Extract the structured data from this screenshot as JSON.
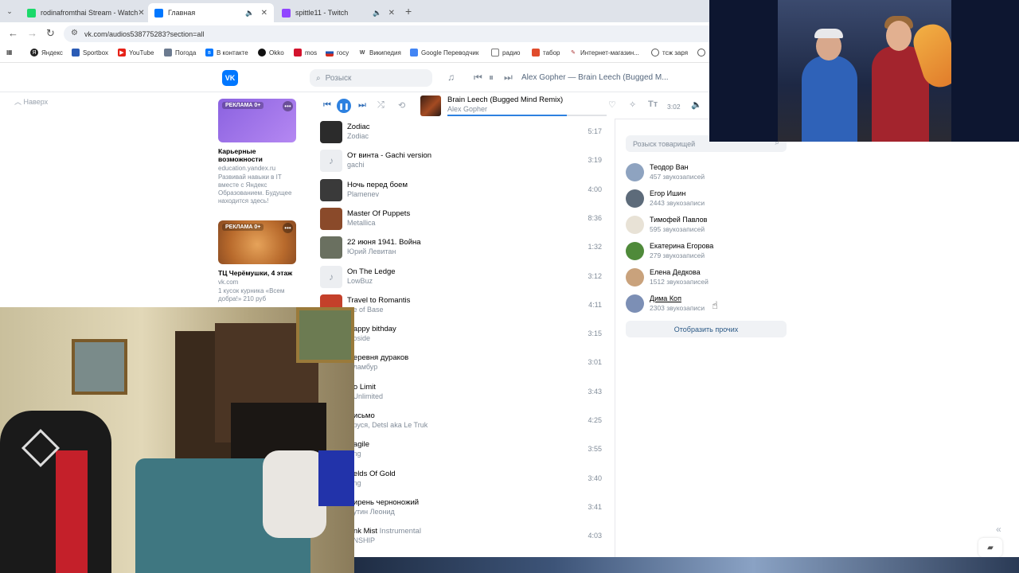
{
  "browser": {
    "tabs": [
      {
        "title": "rodinafromthai Stream - Watch",
        "favicon_color": "#1bd96a",
        "active": false
      },
      {
        "title": "Главная",
        "favicon_color": "#0077ff",
        "active": true
      },
      {
        "title": "spittle11 - Twitch",
        "favicon_color": "#9146ff",
        "active": false
      }
    ],
    "url": "vk.com/audios538775283?section=all",
    "bookmarks": [
      {
        "label": "Яндекс",
        "color": "#222"
      },
      {
        "label": "Sportbox",
        "color": "#2a5bb5"
      },
      {
        "label": "YouTube",
        "color": "#e62117"
      },
      {
        "label": "Погода",
        "color": "#6b7a8f"
      },
      {
        "label": "В контакте",
        "color": "#0077ff"
      },
      {
        "label": "Okko",
        "color": "#111"
      },
      {
        "label": "mos",
        "color": "#d3132d"
      },
      {
        "label": "госу",
        "color": "#1f56b3"
      },
      {
        "label": "Википедия",
        "color": "#444"
      },
      {
        "label": "Google Переводчик",
        "color": "#4285f4"
      },
      {
        "label": "радио",
        "color": "#777"
      },
      {
        "label": "табор",
        "color": "#e04c2c"
      },
      {
        "label": "Интернет-магазин...",
        "color": "#a33"
      },
      {
        "label": "тсж заря",
        "color": "#555"
      }
    ]
  },
  "vk": {
    "search_placeholder": "Розыск",
    "header_now_playing": "Alex Gopher — Brain Leech (Bugged M...",
    "back_link": "Наверх",
    "ads": [
      {
        "badge": "РЕКЛАМА 0+",
        "title": "Карьерные возможности",
        "domain": "education.yandex.ru",
        "text": "Развивай навыки в IT вместе с Яндекс Образованием. Будущее находится здесь!"
      },
      {
        "badge": "РЕКЛАМА 0+",
        "title": "ТЦ Черёмушки, 4 этаж",
        "domain": "vk.com",
        "text": "1 кусок курника «Всем добра!» 210 руб"
      }
    ],
    "player": {
      "title": "Brain Leech (Bugged Mind Remix)",
      "artist": "Alex Gopher",
      "time": "3:02",
      "progress": 0.75
    },
    "tracks": [
      {
        "title": "Zodiac",
        "subtitle": "",
        "artist": "Zodiac",
        "duration": "5:17",
        "cover": "#2b2b2b",
        "note": false
      },
      {
        "title": "От винта - Gachi version",
        "subtitle": "",
        "artist": "gachi",
        "duration": "3:19",
        "cover": "#eceef1",
        "note": true
      },
      {
        "title": "Ночь перед боем",
        "subtitle": "",
        "artist": "Plamenev",
        "duration": "4:00",
        "cover": "#3a3a3a",
        "note": false
      },
      {
        "title": "Master Of Puppets",
        "subtitle": "",
        "artist": "Metallica",
        "duration": "8:36",
        "cover": "#8a4a2a",
        "note": false
      },
      {
        "title": "22 июня 1941. Война",
        "subtitle": "",
        "artist": "Юрий Левитан",
        "duration": "1:32",
        "cover": "#6a7060",
        "note": false
      },
      {
        "title": "On The Ledge",
        "subtitle": "",
        "artist": "LowBuz",
        "duration": "3:12",
        "cover": "#eceef1",
        "note": true
      },
      {
        "title": "Travel to Romantis",
        "subtitle": "",
        "artist": "...e of Base",
        "duration": "4:11",
        "cover": "#c4402a",
        "note": false
      },
      {
        "title": "...appy bithday",
        "subtitle": "",
        "artist": "...oside",
        "duration": "3:15",
        "cover": "#eceef1",
        "note": true
      },
      {
        "title": "...еревня дураков",
        "subtitle": "",
        "artist": "...ламбур",
        "duration": "3:01",
        "cover": "#eceef1",
        "note": true
      },
      {
        "title": "...o Limit",
        "subtitle": "",
        "artist": "...Unlimited",
        "duration": "3:43",
        "cover": "#eceef1",
        "note": true
      },
      {
        "title": "...исьмо",
        "subtitle": "",
        "artist": "...руся, Detsl aka Le Truk",
        "duration": "4:25",
        "cover": "#eceef1",
        "note": true
      },
      {
        "title": "...agile",
        "subtitle": "",
        "artist": "...ng",
        "duration": "3:55",
        "cover": "#eceef1",
        "note": true
      },
      {
        "title": "...elds Of Gold",
        "subtitle": "",
        "artist": "...ng",
        "duration": "3:40",
        "cover": "#eceef1",
        "note": true
      },
      {
        "title": "...ирень черноножий",
        "subtitle": "",
        "artist": "...утин Леонид",
        "duration": "3:41",
        "cover": "#eceef1",
        "note": true
      },
      {
        "title": "...nk Mist",
        "subtitle": "Instrumental",
        "artist": "...NSHIP",
        "duration": "4:03",
        "cover": "#eceef1",
        "note": true
      }
    ],
    "friends_search_placeholder": "Розыск товарищей",
    "friends": [
      {
        "name": "Теодор Ван",
        "count": "457 звукозаписей",
        "avatar": "#8ea3c0",
        "underline": false
      },
      {
        "name": "Егор Ишин",
        "count": "2443 звукозаписи",
        "avatar": "#5d6b7a",
        "underline": false
      },
      {
        "name": "Тимофей Павлов",
        "count": "595 звукозаписей",
        "avatar": "#e8e2d6",
        "underline": false
      },
      {
        "name": "Екатерина Егорова",
        "count": "279 звукозаписей",
        "avatar": "#4f8a3a",
        "underline": false
      },
      {
        "name": "Елена Дедкова",
        "count": "1512 звукозаписей",
        "avatar": "#c9a27c",
        "underline": false
      },
      {
        "name": "Дима Коп",
        "count": "2303 звукозаписи",
        "avatar": "#7c8fb5",
        "underline": true
      }
    ],
    "show_more": "Отобразить прочих"
  }
}
